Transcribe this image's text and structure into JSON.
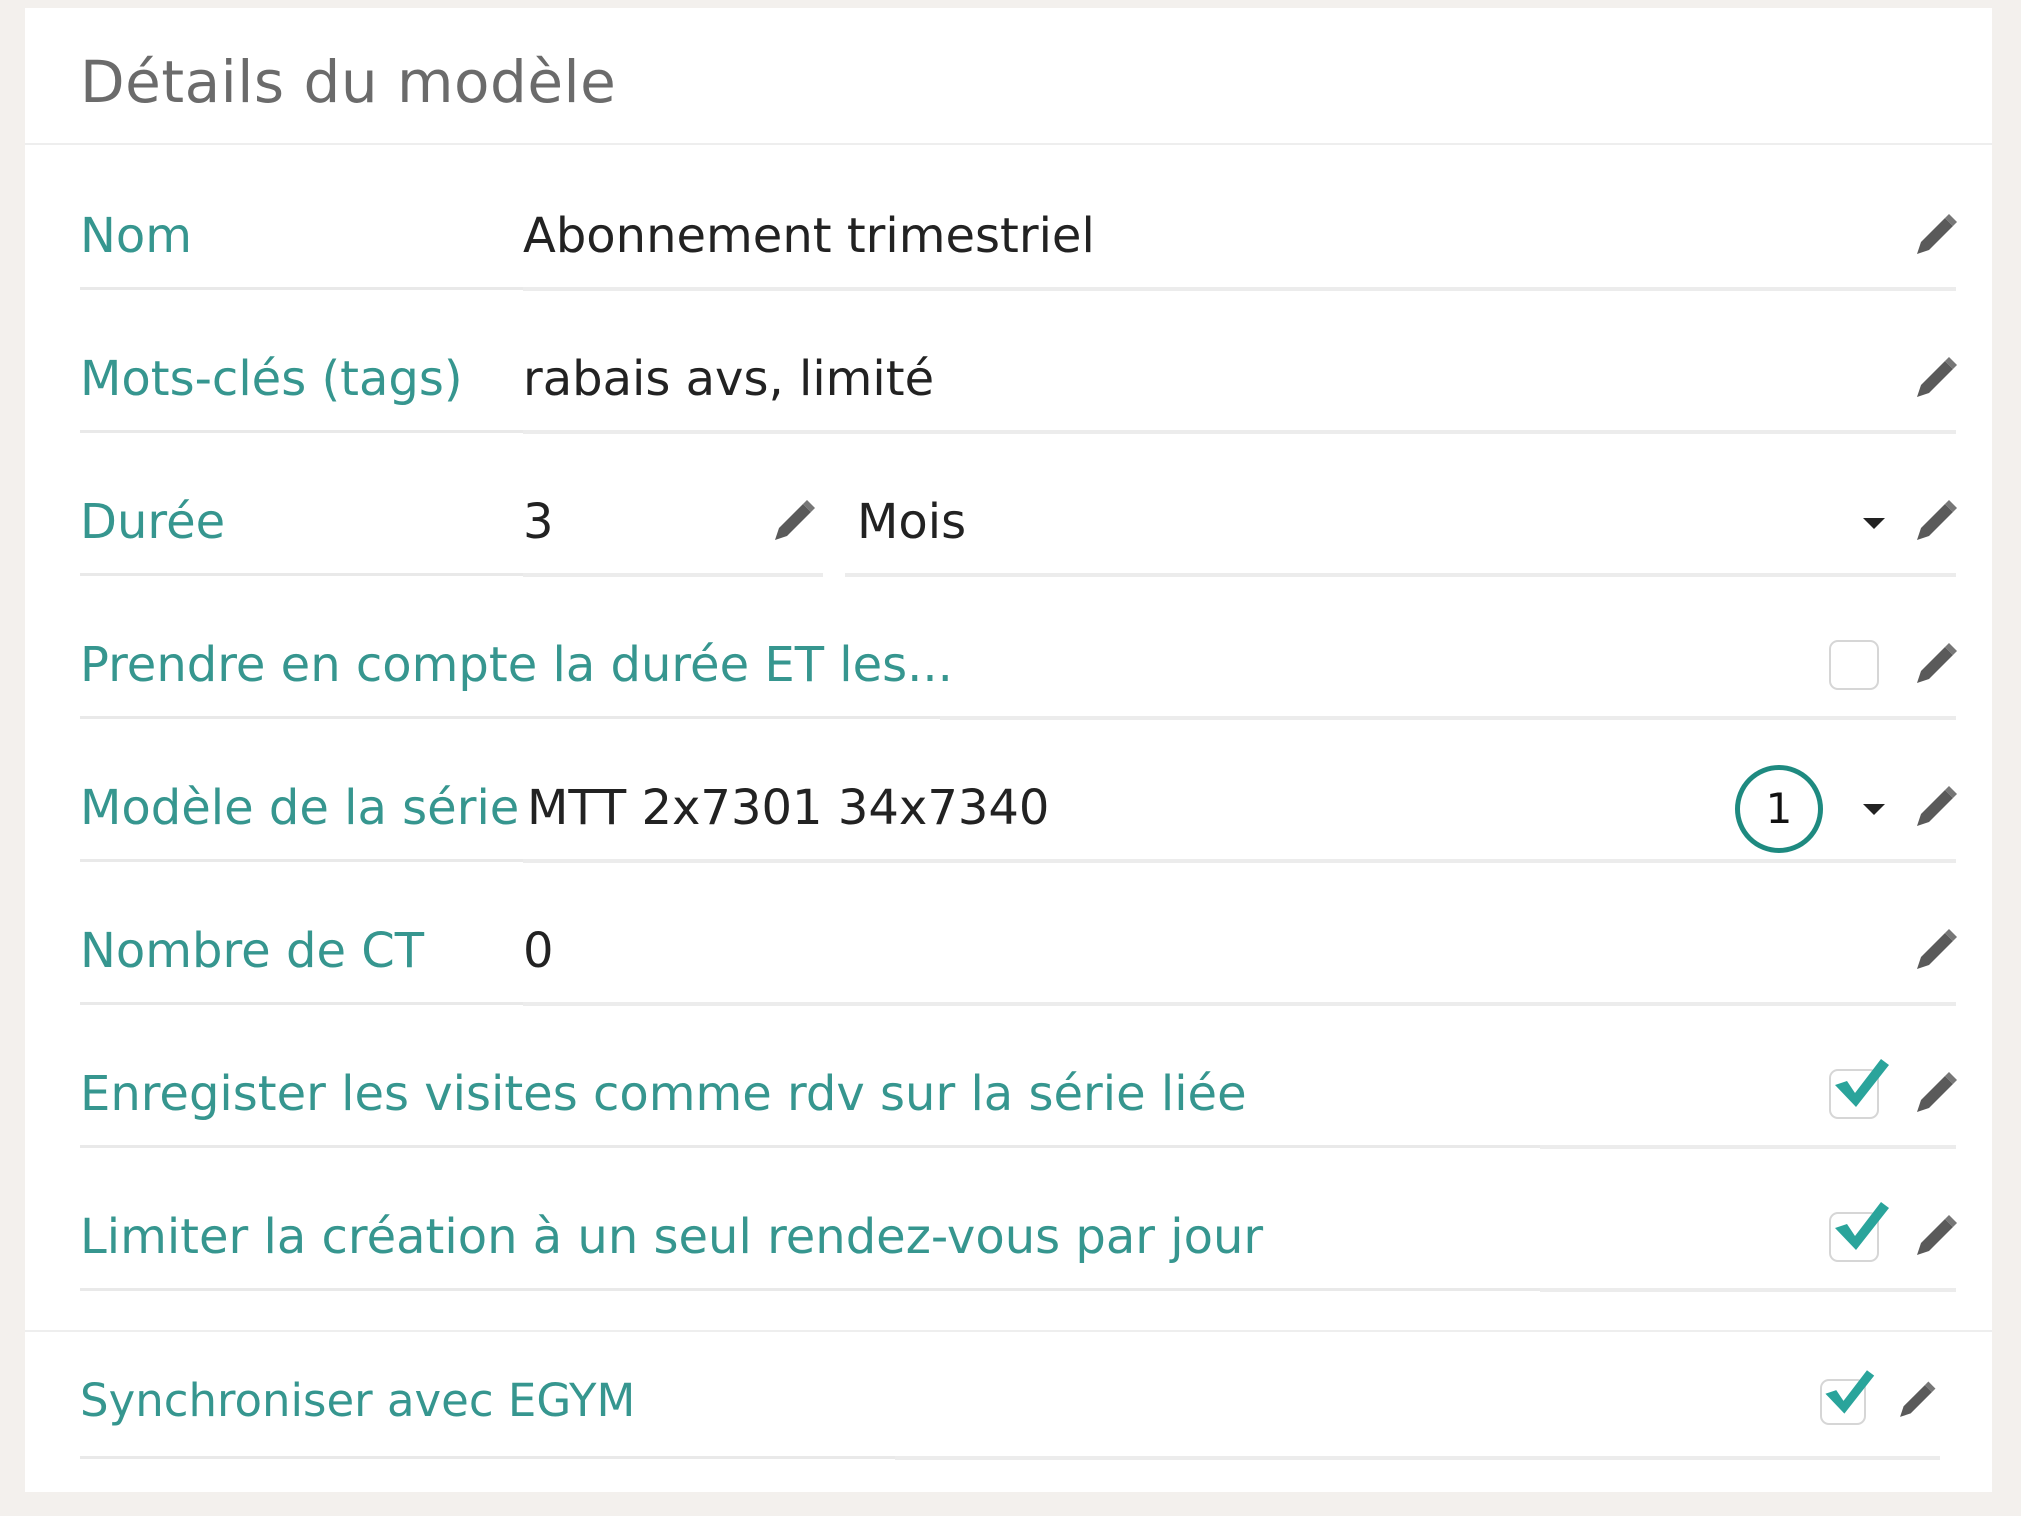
{
  "panel": {
    "title": "Détails du modèle"
  },
  "fields": {
    "nom": {
      "label": "Nom",
      "value": "Abonnement trimestriel"
    },
    "tags": {
      "label": "Mots-clés (tags)",
      "value": "rabais avs, limité"
    },
    "duree": {
      "label": "Durée",
      "value": "3",
      "unit": "Mois"
    },
    "prendre": {
      "label": "Prendre en compte la durée ET les...",
      "checked": false
    },
    "serie": {
      "label": "Modèle de la série",
      "value": "MTT 2x7301 34x7340",
      "badge": "1"
    },
    "ct": {
      "label": "Nombre de CT",
      "value": "0"
    },
    "enregistrer": {
      "label": "Enregister les visites comme rdv sur la série liée",
      "checked": true
    },
    "limiter": {
      "label": "Limiter la création à un seul rendez-vous par jour",
      "checked": true
    },
    "egym": {
      "label": "Synchroniser avec EGYM",
      "checked": true
    }
  },
  "icons": {
    "edit": "pencil-icon",
    "dropdown": "caret-down-icon",
    "check": "checkmark-icon"
  },
  "colors": {
    "label": "#36968f",
    "check": "#2aa49b",
    "badge_border": "#1e8a80",
    "pencil": "#5a5a5a"
  }
}
